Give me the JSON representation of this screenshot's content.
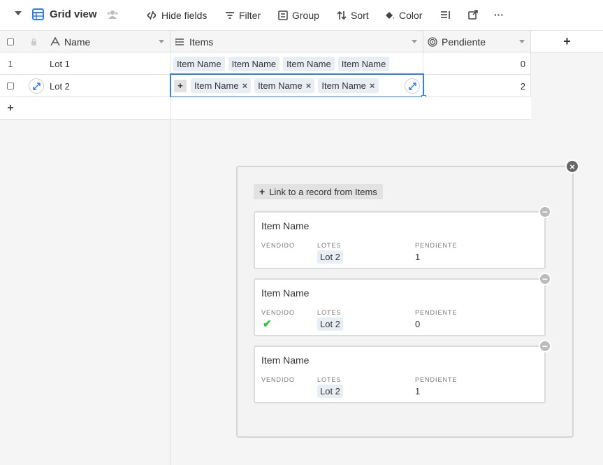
{
  "toolbar": {
    "view_name": "Grid view",
    "hide_fields": "Hide fields",
    "filter": "Filter",
    "group": "Group",
    "sort": "Sort",
    "color": "Color",
    "more": "···"
  },
  "columns": {
    "name": "Name",
    "items": "Items",
    "pendiente": "Pendiente",
    "add": "+"
  },
  "rows": [
    {
      "num": "1",
      "name": "Lot 1",
      "items": [
        "Item Name",
        "Item Name",
        "Item Name",
        "Item Name"
      ],
      "pendiente": "0"
    },
    {
      "num": "",
      "name": "Lot 2",
      "items": [
        "Item Name",
        "Item Name",
        "Item Name"
      ],
      "pendiente": "2"
    }
  ],
  "add_row": "+",
  "panel": {
    "close": "×",
    "link_button": "Link to a record from Items",
    "link_plus": "+",
    "field_labels": {
      "vendido": "VENDIDO",
      "lotes": "LOTES",
      "pendiente": "PENDIENTE"
    },
    "cards": [
      {
        "title": "Item Name",
        "vendido": "",
        "lote": "Lot 2",
        "pendiente": "1"
      },
      {
        "title": "Item Name",
        "vendido": "✔",
        "lote": "Lot 2",
        "pendiente": "0"
      },
      {
        "title": "Item Name",
        "vendido": "",
        "lote": "Lot 2",
        "pendiente": "1"
      }
    ],
    "remove_symbol": "−"
  },
  "colors": {
    "accent_blue": "#2d7ff9",
    "check_green": "#20c933",
    "chip_bg": "#e9eef5"
  }
}
